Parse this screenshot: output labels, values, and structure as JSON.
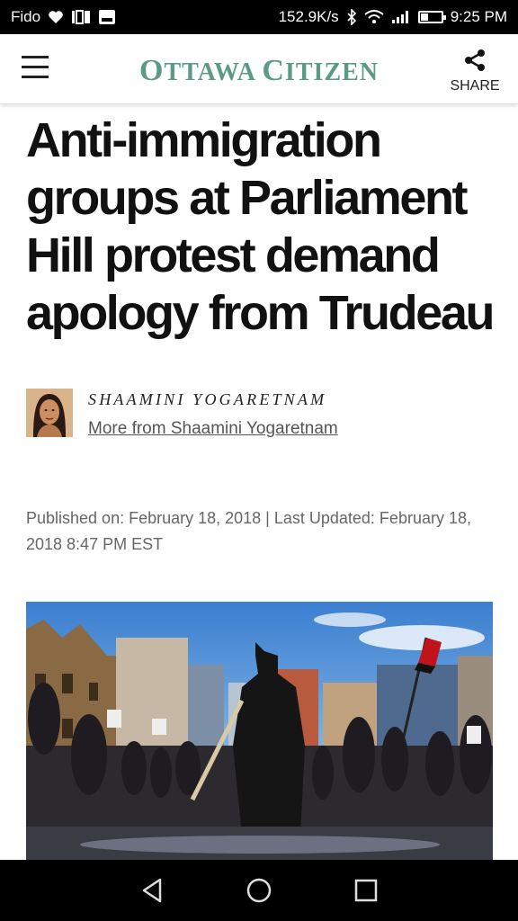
{
  "status_bar": {
    "carrier": "Fido",
    "speed": "152.9K/s",
    "battery_level": 0.35,
    "time": "9:25 PM"
  },
  "header": {
    "brand_first": "O",
    "brand_first_rest": "TTAWA ",
    "brand_second": "C",
    "brand_second_rest": "ITIZEN",
    "brand_color": "#5b9b86",
    "share_label": "SHARE"
  },
  "article": {
    "headline": "Anti-immigration groups at Parliament Hill protest demand apology from Trudeau",
    "author_name": "SHAAMINI YOGARETNAM",
    "author_more": "More from Shaamini Yogaretnam",
    "published": "Published on: February 18, 2018 | Last Updated: February 18, 2018 8:47 PM EST"
  },
  "icons": {
    "menu": "hamburger-icon",
    "share": "share-icon",
    "back": "back-icon",
    "home": "home-icon",
    "recents": "recents-icon"
  }
}
